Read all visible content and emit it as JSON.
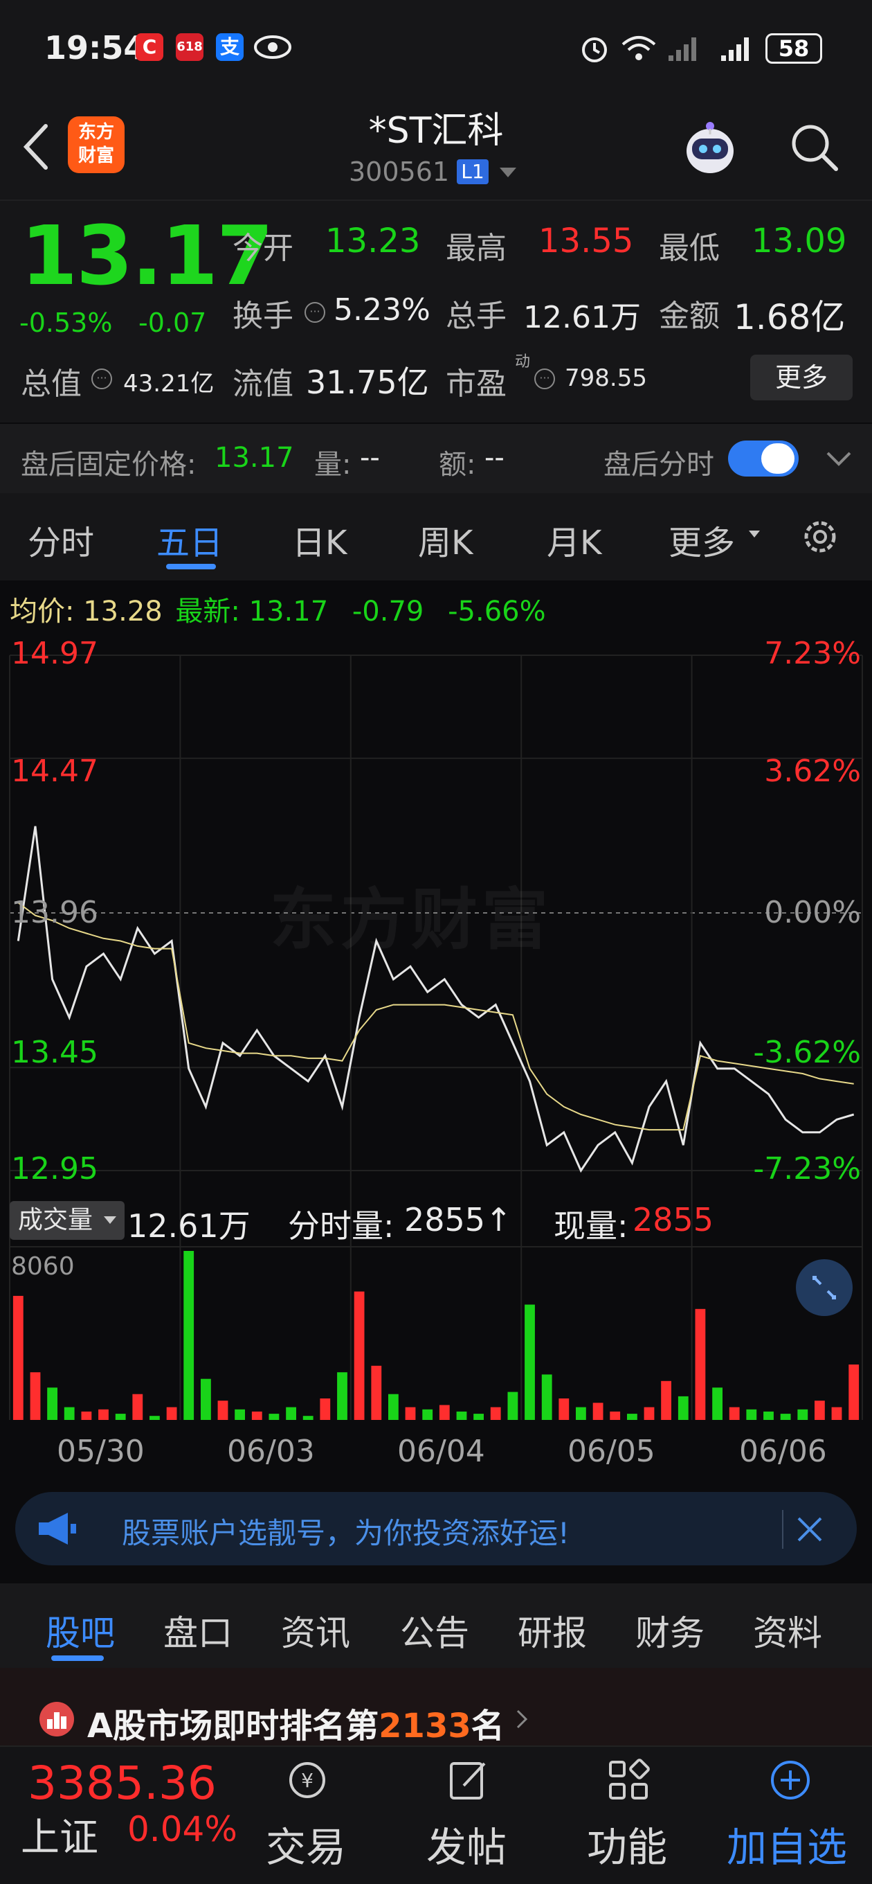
{
  "status_bar": {
    "time": "19:54",
    "battery": "58"
  },
  "header": {
    "title": "*ST汇科",
    "code": "300561",
    "level": "L1",
    "logo_text_1": "东方",
    "logo_text_2": "财富"
  },
  "quote": {
    "price": "13.17",
    "change_pct": "-0.53%",
    "change_abs": "-0.07",
    "open_label": "今开",
    "open": "13.23",
    "high_label": "最高",
    "high": "13.55",
    "low_label": "最低",
    "low": "13.09",
    "turnover_label": "换手",
    "turnover": "5.23%",
    "volume_label": "总手",
    "volume": "12.61万",
    "amount_label": "金额",
    "amount": "1.68亿",
    "mktcap_label": "总值",
    "mktcap": "43.21亿",
    "float_label": "流值",
    "float_cap": "31.75亿",
    "pe_label": "市盈",
    "pe_sup": "动",
    "pe": "798.55",
    "more_button": "更多"
  },
  "after_hours": {
    "price_label": "盘后固定价格:",
    "price": "13.17",
    "vol_label": "量:",
    "vol": "--",
    "amt_label": "额:",
    "amt": "--",
    "toggle_label": "盘后分时",
    "toggle_on": true
  },
  "chart_tabs": [
    "分时",
    "五日",
    "日K",
    "周K",
    "月K",
    "更多"
  ],
  "chart_header": {
    "avg_label": "均价:",
    "avg": "13.28",
    "last_label": "最新:",
    "last": "13.17",
    "chg": "-0.79",
    "chg_pct": "-5.66%"
  },
  "chart_data": {
    "type": "line",
    "title": "",
    "x": [
      "05/30",
      "06/03",
      "06/04",
      "06/05",
      "06/06"
    ],
    "ylim": [
      12.95,
      14.97
    ],
    "y_ticks_left": [
      "14.97",
      "14.47",
      "13.96",
      "13.45",
      "12.95"
    ],
    "y_ticks_right": [
      "7.23%",
      "3.62%",
      "0.00%",
      "-3.62%",
      "-7.23%"
    ],
    "series": [
      {
        "name": "",
        "color": "#e6e6e6",
        "values": [
          13.85,
          14.3,
          13.7,
          13.55,
          13.75,
          13.8,
          13.7,
          13.9,
          13.8,
          13.85,
          13.35,
          13.2,
          13.45,
          13.4,
          13.5,
          13.4,
          13.35,
          13.3,
          13.4,
          13.2,
          13.55,
          13.85,
          13.7,
          13.75,
          13.65,
          13.7,
          13.6,
          13.55,
          13.6,
          13.45,
          13.3,
          13.05,
          13.1,
          12.95,
          13.05,
          13.1,
          12.98,
          13.2,
          13.3,
          13.05,
          13.45,
          13.35,
          13.35,
          13.3,
          13.25,
          13.15,
          13.1,
          13.1,
          13.15,
          13.17
        ]
      },
      {
        "name": "",
        "color": "#e8d98a",
        "values": [
          14.0,
          13.95,
          13.93,
          13.9,
          13.88,
          13.86,
          13.85,
          13.83,
          13.82,
          13.82,
          13.45,
          13.43,
          13.42,
          13.41,
          13.41,
          13.4,
          13.4,
          13.39,
          13.39,
          13.38,
          13.5,
          13.58,
          13.6,
          13.6,
          13.6,
          13.6,
          13.59,
          13.58,
          13.57,
          13.56,
          13.35,
          13.25,
          13.2,
          13.17,
          13.15,
          13.13,
          13.12,
          13.11,
          13.11,
          13.11,
          13.4,
          13.38,
          13.37,
          13.36,
          13.35,
          13.34,
          13.33,
          13.31,
          13.3,
          13.29
        ]
      }
    ],
    "volume": {
      "label": "成交量",
      "total": "12.61万",
      "period_label": "分时量:",
      "period_value": "2855↑",
      "now_label": "现量:",
      "now_value": "2855",
      "max_tick": "8060",
      "values": [
        6000,
        2500,
        1800,
        900,
        700,
        800,
        600,
        1500,
        500,
        900,
        8060,
        2200,
        1200,
        800,
        700,
        600,
        900,
        500,
        1300,
        2500,
        6200,
        2800,
        1500,
        900,
        800,
        1000,
        700,
        600,
        900,
        1600,
        5600,
        2400,
        1300,
        900,
        1100,
        700,
        600,
        900,
        2100,
        1400,
        5400,
        1800,
        900,
        800,
        700,
        600,
        800,
        1200,
        900,
        2855
      ]
    }
  },
  "banner": {
    "text": "股票账户选靓号，为你投资添好运!"
  },
  "info_tabs": [
    "股吧",
    "盘口",
    "资讯",
    "公告",
    "研报",
    "财务",
    "资料"
  ],
  "rank": {
    "prefix": "A股市场即时排名第",
    "number": "2133",
    "suffix": "名"
  },
  "bottom_nav": {
    "index_value": "3385.36",
    "index_name": "上证",
    "index_change": "0.04%",
    "items": [
      "交易",
      "发帖",
      "功能",
      "加自选"
    ]
  },
  "colors": {
    "up": "#ff2e2e",
    "down": "#19d419",
    "accent": "#3d8cff",
    "avg_line": "#e8d98a"
  }
}
